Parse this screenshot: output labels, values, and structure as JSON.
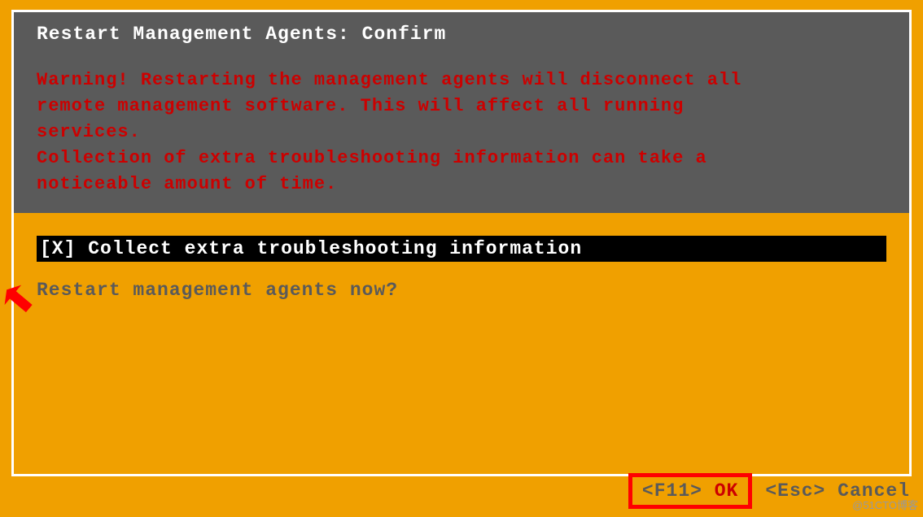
{
  "dialog": {
    "title": "Restart Management Agents: Confirm",
    "warning": "Warning! Restarting the management agents will disconnect all\nremote management software. This will affect all running\nservices.\nCollection of extra troubleshooting information can take a\nnoticeable amount of time.",
    "checkbox": {
      "checked_marker": "[X]",
      "label": "Collect extra troubleshooting information"
    },
    "prompt": "Restart management agents now?",
    "buttons": {
      "ok": {
        "key": "<F11>",
        "label": "OK"
      },
      "cancel": {
        "key": "<Esc>",
        "label": "Cancel"
      }
    }
  },
  "watermark": "@51CTO博客"
}
